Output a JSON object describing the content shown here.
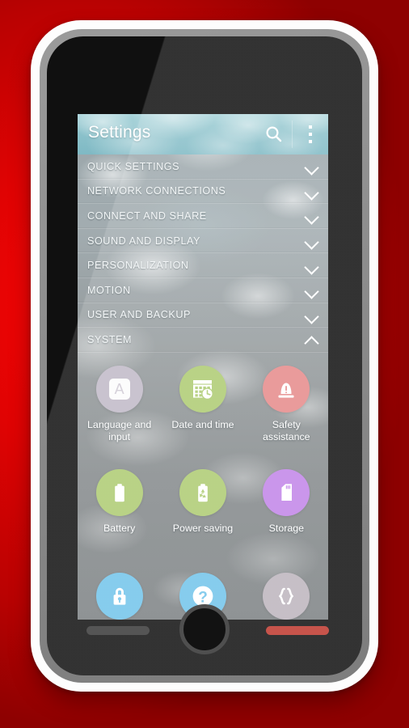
{
  "backdrop": {
    "color": "#d10202"
  },
  "device": {
    "frame_color": "#fdfdfd",
    "bezel_color": "#8d8d8d",
    "screen_color": "#101010",
    "home_button_name": "home-button",
    "softkey_left_name": "menu-softkey",
    "softkey_right_name": "back-softkey",
    "softkey_right_color": "#c7544b"
  },
  "header": {
    "title": "Settings",
    "background_color": "#8cc2cb",
    "search_icon": "search-icon",
    "overflow_icon": "overflow-menu-icon"
  },
  "categories": [
    {
      "label": "QUICK SETTINGS",
      "expanded": false,
      "chevron": "chevron-down-icon"
    },
    {
      "label": "NETWORK CONNECTIONS",
      "expanded": false,
      "chevron": "chevron-down-icon"
    },
    {
      "label": "CONNECT AND SHARE",
      "expanded": false,
      "chevron": "chevron-down-icon"
    },
    {
      "label": "SOUND AND DISPLAY",
      "expanded": false,
      "chevron": "chevron-down-icon"
    },
    {
      "label": "PERSONALIZATION",
      "expanded": false,
      "chevron": "chevron-down-icon"
    },
    {
      "label": "MOTION",
      "expanded": false,
      "chevron": "chevron-down-icon"
    },
    {
      "label": "USER AND BACKUP",
      "expanded": false,
      "chevron": "chevron-down-icon"
    },
    {
      "label": "SYSTEM",
      "expanded": true,
      "chevron": "chevron-up-icon"
    }
  ],
  "system_items": [
    {
      "label": "Language and input",
      "icon": "keyboard-a-icon",
      "color": "#c0b9c7"
    },
    {
      "label": "Date and time",
      "icon": "calendar-clock-icon",
      "color": "#adcb72"
    },
    {
      "label": "Safety assistance",
      "icon": "siren-alert-icon",
      "color": "#e58a8a"
    },
    {
      "label": "Battery",
      "icon": "battery-icon",
      "color": "#adcb72"
    },
    {
      "label": "Power saving",
      "icon": "battery-recycle-icon",
      "color": "#adcb72"
    },
    {
      "label": "Storage",
      "icon": "sd-card-icon",
      "color": "#c184e8"
    },
    {
      "label": "",
      "icon": "lock-icon",
      "color": "#72c4ea"
    },
    {
      "label": "",
      "icon": "question-help-icon",
      "color": "#72c4ea"
    },
    {
      "label": "",
      "icon": "braces-developer-icon",
      "color": "#bcb4bd"
    }
  ]
}
